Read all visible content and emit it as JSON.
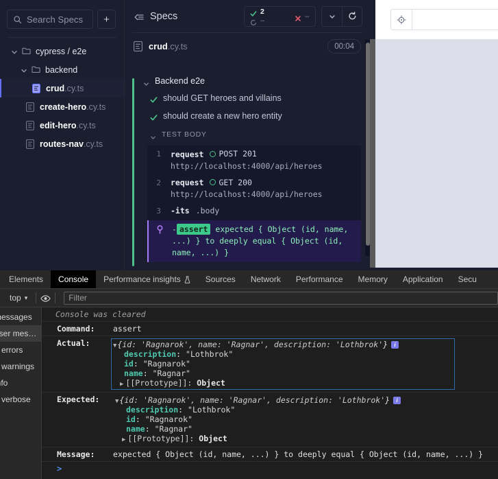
{
  "specs_sidebar": {
    "search_placeholder": "Search Specs",
    "add_button_label": "+",
    "tree": [
      {
        "label": "cypress / e2e",
        "type": "folder",
        "depth": 0,
        "expanded": true
      },
      {
        "label": "backend",
        "type": "folder",
        "depth": 1,
        "expanded": true
      },
      {
        "name": "crud",
        "ext": ".cy.ts",
        "type": "file",
        "depth": 2,
        "selected": true
      },
      {
        "name": "create-hero",
        "ext": ".cy.ts",
        "type": "file",
        "depth": 1,
        "selected": false
      },
      {
        "name": "edit-hero",
        "ext": ".cy.ts",
        "type": "file",
        "depth": 1,
        "selected": false
      },
      {
        "name": "routes-nav",
        "ext": ".cy.ts",
        "type": "file",
        "depth": 1,
        "selected": false
      }
    ]
  },
  "runner": {
    "title": "Specs",
    "stats": {
      "passed": "2",
      "failed": "--",
      "pending": "--"
    },
    "spec_file": {
      "name": "crud",
      "ext": ".cy.ts",
      "duration": "00:04"
    },
    "suite": "Backend e2e",
    "tests": [
      {
        "status": "passed",
        "title": "should GET heroes and villains"
      },
      {
        "status": "passed",
        "title": "should create a new hero entity"
      }
    ],
    "test_body_label": "TEST BODY",
    "commands": [
      {
        "num": "1",
        "name": "request",
        "meta": "POST 201",
        "url": "http://localhost:4000/api/heroes"
      },
      {
        "num": "2",
        "name": "request",
        "meta": "GET 200",
        "url": "http://localhost:4000/api/heroes"
      },
      {
        "num": "3",
        "name": "-its",
        "meta": ".body",
        "url": ""
      }
    ],
    "assertion": {
      "dash": "-",
      "keyword": "assert",
      "text": "expected { Object (id, name, ...) } to deeply equal { Object (id, name, ...) }"
    }
  },
  "preview": {
    "selector_icon": "crosshair-target-icon",
    "url_value": ""
  },
  "devtools": {
    "tabs": [
      {
        "label": "Elements",
        "active": false
      },
      {
        "label": "Console",
        "active": true
      },
      {
        "label": "Performance insights",
        "active": false,
        "icon": "flask-icon"
      },
      {
        "label": "Sources",
        "active": false
      },
      {
        "label": "Network",
        "active": false
      },
      {
        "label": "Performance",
        "active": false
      },
      {
        "label": "Memory",
        "active": false
      },
      {
        "label": "Application",
        "active": false
      },
      {
        "label": "Secu",
        "active": false
      }
    ],
    "toolbar": {
      "context": "top",
      "context_caret": "▾",
      "eye_icon": "eye-icon",
      "filter_placeholder": "Filter"
    },
    "sidebar_items": [
      {
        "label": "messages",
        "selected": false
      },
      {
        "label": "user mes…",
        "selected": true
      },
      {
        "label": "o errors",
        "selected": false
      },
      {
        "label": "o warnings",
        "selected": false
      },
      {
        "label": "info",
        "selected": false
      },
      {
        "label": "o verbose",
        "selected": false
      }
    ],
    "console": {
      "cleared_message": "Console was cleared",
      "rows": [
        {
          "key": "Command:",
          "value": "assert"
        }
      ],
      "actual": {
        "key": "Actual:",
        "head_prefix": "{",
        "head_pairs": "id: 'Ragnarok', name: 'Ragnar', description: 'Lothbrok'",
        "head_suffix": "}",
        "props": [
          {
            "name": "description",
            "value": "\"Lothbrok\""
          },
          {
            "name": "id",
            "value": "\"Ragnarok\""
          },
          {
            "name": "name",
            "value": "\"Ragnar\""
          }
        ],
        "prototype": "[[Prototype]]:",
        "prototype_value": "Object",
        "badge": "i"
      },
      "expected": {
        "key": "Expected:",
        "head_prefix": "{",
        "head_pairs": "id: 'Ragnarok', name: 'Ragnar', description: 'Lothbrok'",
        "head_suffix": "}",
        "props": [
          {
            "name": "description",
            "value": "\"Lothbrok\""
          },
          {
            "name": "id",
            "value": "\"Ragnarok\""
          },
          {
            "name": "name",
            "value": "\"Ragnar\""
          }
        ],
        "prototype": "[[Prototype]]:",
        "prototype_value": "Object",
        "badge": "i"
      },
      "message": {
        "key": "Message:",
        "value": "expected { Object (id, name, ...) } to deeply equal { Object (id, name, ...) }"
      },
      "prompt": ">"
    }
  },
  "colors": {
    "cypress_bg": "#1b1e2e",
    "pass_green": "#4fc08a",
    "fail_red": "#e05a6e",
    "assert_purple": "#a47cf7",
    "selection_indigo": "#6470f3",
    "devtools_bg": "#282828",
    "console_bg": "#1e1e1e",
    "obj_border_blue": "#2d6ca8"
  }
}
